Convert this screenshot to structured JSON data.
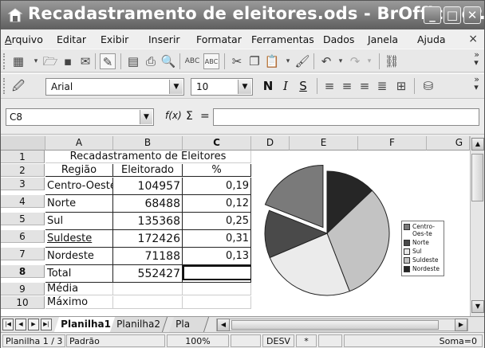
{
  "window": {
    "title": "Recadastramento de eleitores.ods - BrOffice.or...",
    "controls": {
      "minimize": "_",
      "maximize": "□",
      "close": "✕"
    }
  },
  "menubar": {
    "items": [
      {
        "label": "Arquivo",
        "mnemonic": "A"
      },
      {
        "label": "Editar",
        "mnemonic": "E"
      },
      {
        "label": "Exibir",
        "mnemonic": "x"
      },
      {
        "label": "Inserir",
        "mnemonic": "I"
      },
      {
        "label": "Formatar",
        "mnemonic": "o"
      },
      {
        "label": "Ferramentas",
        "mnemonic": "n"
      },
      {
        "label": "Dados",
        "mnemonic": "D"
      },
      {
        "label": "Janela",
        "mnemonic": "J"
      },
      {
        "label": "Ajuda",
        "mnemonic": "u"
      }
    ],
    "close_glyph": "×"
  },
  "format_toolbar": {
    "font_name": "Arial",
    "font_size": "10",
    "bold": "N",
    "italic": "I",
    "underline": "S"
  },
  "formula_bar": {
    "cell_ref": "C8",
    "fx": "f(x)",
    "sum": "Σ",
    "equals": "=",
    "content": ""
  },
  "sheet": {
    "columns": [
      "A",
      "B",
      "C",
      "D",
      "E",
      "F",
      "G"
    ],
    "rows": [
      "1",
      "2",
      "3",
      "4",
      "5",
      "6",
      "7",
      "8",
      "9",
      "10"
    ],
    "selected_row": "8",
    "title": "Recadastramento de Eleitores",
    "headers": [
      "Região",
      "Eleitorado",
      "%"
    ],
    "data": [
      {
        "region": "Centro-Oeste",
        "electorate": "104957",
        "pct": "0,19"
      },
      {
        "region": "Norte",
        "electorate": "68488",
        "pct": "0,12"
      },
      {
        "region": "Sul",
        "electorate": "135368",
        "pct": "0,25"
      },
      {
        "region": "Suldeste",
        "electorate": "172426",
        "pct": "0,31"
      },
      {
        "region": "Nordeste",
        "electorate": "71188",
        "pct": "0,13"
      }
    ],
    "total_label": "Total",
    "total_value": "552427",
    "media_label": "Média",
    "maximo_label": "Máximo"
  },
  "chart_data": {
    "type": "pie",
    "categories": [
      "Centro-Oeste",
      "Norte",
      "Sul",
      "Suldeste",
      "Nordeste"
    ],
    "values": [
      104957,
      68488,
      135368,
      172426,
      71188
    ],
    "colors": [
      "#7a7a7a",
      "#4a4a4a",
      "#ebebeb",
      "#c3c3c3",
      "#262626"
    ],
    "exploded": "Centro-Oeste",
    "legend_position": "right",
    "legend": [
      "Centro-Oes-te",
      "Norte",
      "Sul",
      "Suldeste",
      "Nordeste"
    ]
  },
  "tabs": {
    "sheets": [
      "Planilha1",
      "Planilha2",
      "Pla"
    ],
    "active": "Planilha1"
  },
  "statusbar": {
    "sheet": "Planilha 1 / 3",
    "style": "Padrão",
    "zoom": "100%",
    "mode": "DESV",
    "modified": "*",
    "sum": "Soma=0"
  }
}
